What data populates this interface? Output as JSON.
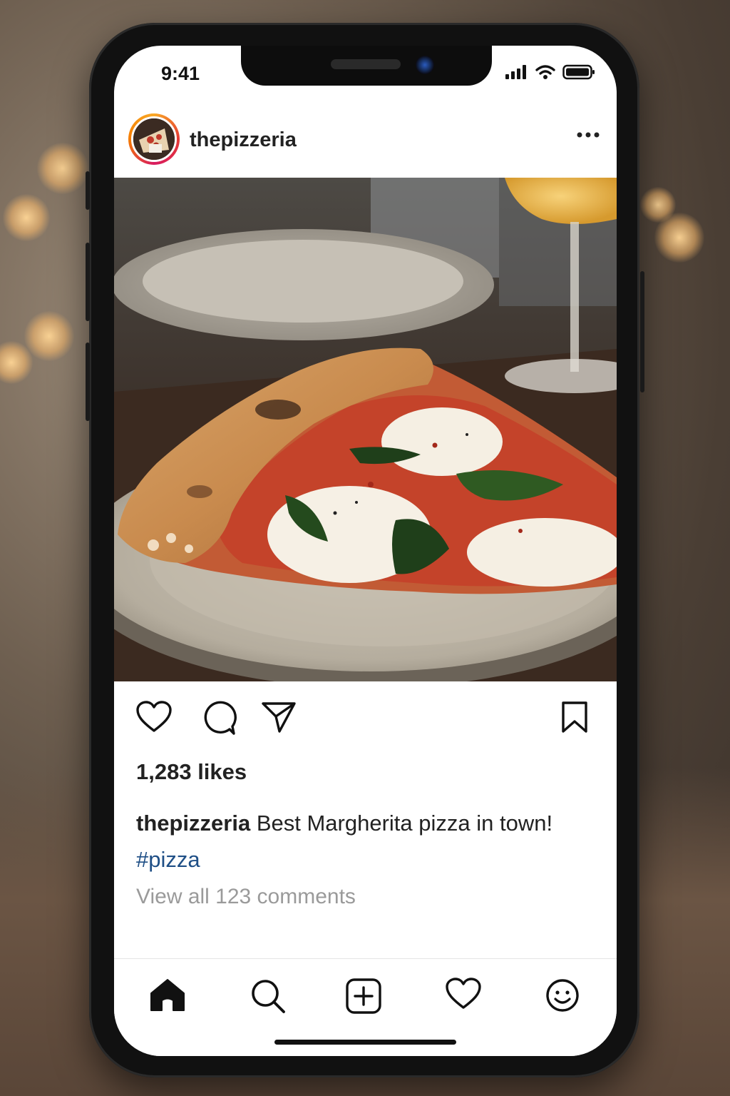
{
  "status_bar": {
    "time": "9:41"
  },
  "post": {
    "username": "thepizzeria",
    "likes": "1,283 likes",
    "caption_user": "thepizzeria",
    "caption_text": " Best Margherita pizza in town!",
    "hashtag": "#pizza",
    "view_comments": "View all 123 comments"
  },
  "icons": {
    "header": [
      "more-options-icon"
    ],
    "actions": [
      "heart-icon",
      "comment-icon",
      "share-icon",
      "bookmark-icon"
    ],
    "tabbar": [
      "home-icon",
      "search-icon",
      "add-post-icon",
      "activity-heart-icon",
      "profile-icon"
    ]
  },
  "colors": {
    "hashtag": "#1f4f86",
    "secondary_text": "#9a9a9a",
    "story_ring": [
      "#f9a825",
      "#e53935",
      "#d81b60"
    ]
  }
}
